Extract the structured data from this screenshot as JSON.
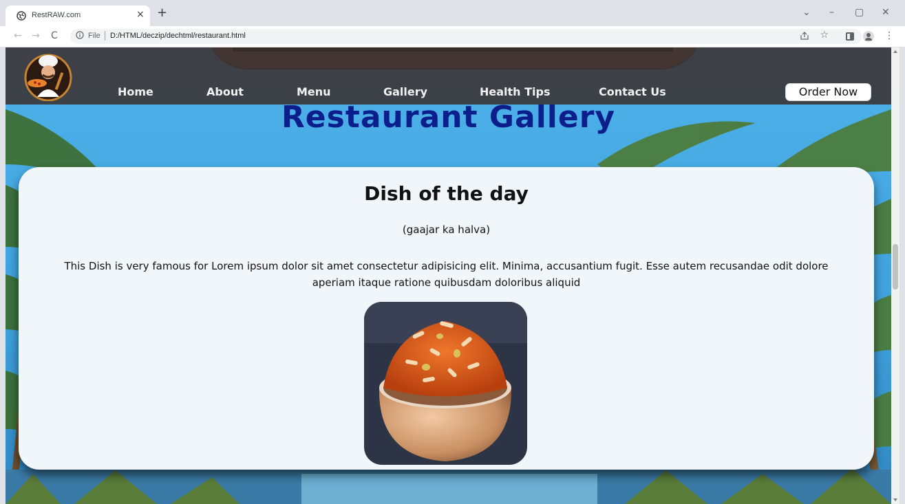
{
  "browser": {
    "tab_title": "RestRAW.com",
    "tab_close": "×",
    "new_tab": "+",
    "file_label": "File",
    "url": "D:/HTML/deczip/dechtml/restaurant.html",
    "win_minimize": "–",
    "win_restore": "▢",
    "win_close": "✕",
    "tab_search": "⌄",
    "back": "←",
    "forward": "→",
    "reload": "C",
    "bookmark": "☆",
    "menu": "⋮"
  },
  "site": {
    "nav": [
      {
        "label": "Home"
      },
      {
        "label": "About"
      },
      {
        "label": "Menu"
      },
      {
        "label": "Gallery"
      },
      {
        "label": "Health Tips"
      },
      {
        "label": "Contact Us"
      }
    ],
    "order_button": "Order Now",
    "page_title": "Restaurant Gallery"
  },
  "card": {
    "title": "Dish of the day",
    "subtitle": "(gaajar ka halva)",
    "description": "This Dish is very famous for Lorem ipsum dolor sit amet consectetur adipisicing elit. Minima, accusantium fugit. Esse autem recusandae odit dolore aperiam itaque ratione quibusdam doloribus aliquid"
  },
  "colors": {
    "title_blue": "#0c1d8c",
    "card_bg": "#f0f6f9",
    "header_bg": "#3a2e2c"
  }
}
